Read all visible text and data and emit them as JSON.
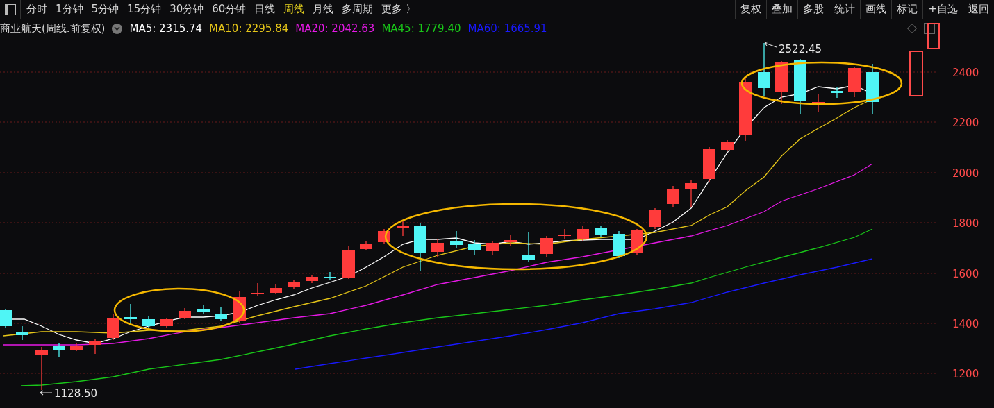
{
  "toolbar": {
    "periods": [
      {
        "label": "分时",
        "selected": false
      },
      {
        "label": "1分钟",
        "selected": false
      },
      {
        "label": "5分钟",
        "selected": false
      },
      {
        "label": "15分钟",
        "selected": false
      },
      {
        "label": "30分钟",
        "selected": false
      },
      {
        "label": "60分钟",
        "selected": false
      },
      {
        "label": "日线",
        "selected": false
      },
      {
        "label": "周线",
        "selected": true
      },
      {
        "label": "月线",
        "selected": false
      },
      {
        "label": "多周期",
        "selected": false
      },
      {
        "label": "更多 〉",
        "selected": false
      }
    ],
    "actions": [
      "复权",
      "叠加",
      "多股",
      "统计",
      "画线",
      "标记",
      "+自选",
      "返回"
    ]
  },
  "legend": {
    "title": "商业航天(周线.前复权)",
    "averages": [
      {
        "label": "MA5: 2315.74",
        "color": "#ffffff"
      },
      {
        "label": "MA10: 2295.84",
        "color": "#e6c619"
      },
      {
        "label": "MA20: 2042.63",
        "color": "#e619e6"
      },
      {
        "label": "MA45: 1779.40",
        "color": "#19c619"
      },
      {
        "label": "MA60: 1665.91",
        "color": "#1919ff"
      }
    ]
  },
  "chart": {
    "high_label": "2522.45",
    "low_label": "1128.50",
    "y_ticks": [
      "2400",
      "2200",
      "2000",
      "1800",
      "1600",
      "1400",
      "1200"
    ]
  }
}
